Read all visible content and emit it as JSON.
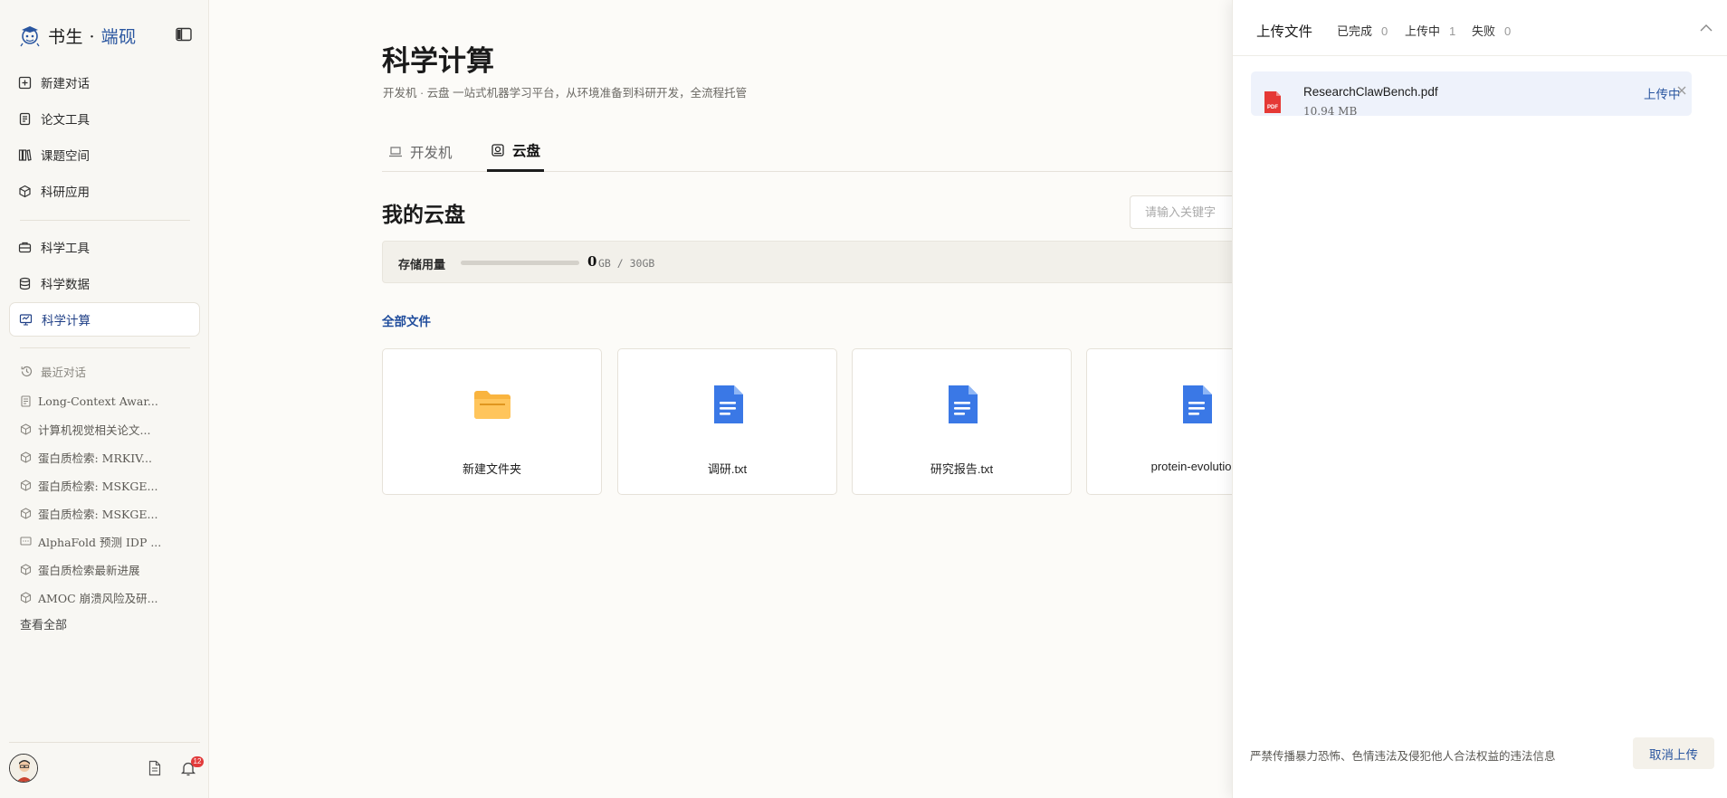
{
  "brand": {
    "name": "书生",
    "separator": " · ",
    "accent": "端砚"
  },
  "nav_primary": [
    {
      "label": "新建对话",
      "icon": "plus-square-icon"
    },
    {
      "label": "论文工具",
      "icon": "document-icon"
    },
    {
      "label": "课题空间",
      "icon": "books-icon"
    },
    {
      "label": "科研应用",
      "icon": "cube-icon"
    }
  ],
  "nav_secondary": [
    {
      "label": "科学工具",
      "icon": "toolbox-icon"
    },
    {
      "label": "科学数据",
      "icon": "database-icon"
    },
    {
      "label": "科学计算",
      "icon": "monitor-icon",
      "active": true
    }
  ],
  "recent": {
    "title": "最近对话",
    "items": [
      {
        "label": "Long-Context Awar...",
        "icon": "document-icon"
      },
      {
        "label": "计算机视觉相关论文...",
        "icon": "cube-icon"
      },
      {
        "label": "蛋白质检索: MRKIV...",
        "icon": "cube-icon"
      },
      {
        "label": "蛋白质检索: MSKGE...",
        "icon": "cube-icon"
      },
      {
        "label": "蛋白质检索: MSKGE...",
        "icon": "cube-icon"
      },
      {
        "label": "AlphaFold 预测 IDP ...",
        "icon": "chat-icon"
      },
      {
        "label": "蛋白质检索最新进展",
        "icon": "cube-icon"
      },
      {
        "label": "AMOC 崩溃风险及研...",
        "icon": "cube-icon"
      }
    ],
    "view_all": "查看全部"
  },
  "notifications": {
    "count": "12"
  },
  "page": {
    "title": "科学计算",
    "subtitle": "开发机 · 云盘 一站式机器学习平台，从环境准备到科研开发，全流程托管"
  },
  "tabs": [
    {
      "label": "开发机",
      "icon": "laptop-icon",
      "active": false
    },
    {
      "label": "云盘",
      "icon": "drive-icon",
      "active": true
    }
  ],
  "drive": {
    "title": "我的云盘",
    "search_placeholder": "请输入关键字",
    "storage": {
      "label": "存储用量",
      "used": "0",
      "total": "GB / 30GB",
      "fraction": 0
    },
    "all_files": "全部文件",
    "files": [
      {
        "name": "新建文件夹",
        "type": "folder",
        "icon": "folder-icon"
      },
      {
        "name": "调研.txt",
        "type": "doc",
        "icon": "doc-file-icon"
      },
      {
        "name": "研究报告.txt",
        "type": "doc",
        "icon": "doc-file-icon"
      },
      {
        "name": "protein-evolution.",
        "type": "doc",
        "icon": "doc-file-icon"
      }
    ]
  },
  "upload": {
    "title": "上传文件",
    "stats": [
      {
        "label": "已完成",
        "value": "0"
      },
      {
        "label": "上传中",
        "value": "1"
      },
      {
        "label": "失败",
        "value": "0"
      }
    ],
    "file": {
      "name": "ResearchClawBench.pdf",
      "size": "10.94 MB",
      "status": "上传中"
    },
    "footer_note": "严禁传播暴力恐怖、色情违法及侵犯他人合法权益的违法信息",
    "cancel_label": "取消上传"
  },
  "colors": {
    "accent": "#2a56a0",
    "folder": "#f9b43f",
    "doc": "#3a78e6",
    "pdf": "#e53935",
    "badge": "#e23b3b"
  }
}
